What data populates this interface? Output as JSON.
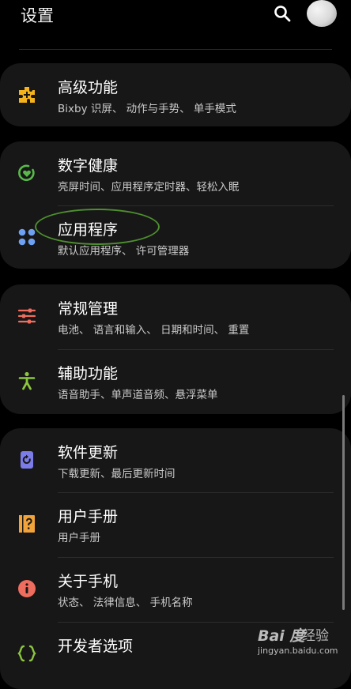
{
  "header": {
    "title": "设置"
  },
  "groups": [
    {
      "items": [
        {
          "label": "高级功能",
          "subtitle": "Bixby 识屏、 动作与手势、 单手模式",
          "icon": "puzzle-icon",
          "icon_color": "#f5b21a"
        }
      ]
    },
    {
      "items": [
        {
          "label": "数字健康",
          "subtitle": "亮屏时间、应用程序定时器、轻松入眠",
          "icon": "digital-wellbeing-icon",
          "icon_color": "#58b94a"
        },
        {
          "label": "应用程序",
          "subtitle": "默认应用程序、 许可管理器",
          "icon": "apps-grid-icon",
          "icon_color": "#6fa1f2"
        }
      ]
    },
    {
      "items": [
        {
          "label": "常规管理",
          "subtitle": "电池、 语言和输入、 日期和时间、 重置",
          "icon": "sliders-icon",
          "icon_color": "#ef6d5e"
        },
        {
          "label": "辅助功能",
          "subtitle": "语音助手、单声道音频、悬浮菜单",
          "icon": "accessibility-icon",
          "icon_color": "#8cc63f"
        }
      ]
    },
    {
      "items": [
        {
          "label": "软件更新",
          "subtitle": "下载更新、最后更新时间",
          "icon": "software-update-icon",
          "icon_color": "#7b7ce8"
        },
        {
          "label": "用户手册",
          "subtitle": "用户手册",
          "icon": "user-manual-icon",
          "icon_color": "#f2a33a"
        },
        {
          "label": "关于手机",
          "subtitle": "状态、 法律信息、 手机名称",
          "icon": "info-icon",
          "icon_color": "#ef6d5e"
        },
        {
          "label": "开发者选项",
          "subtitle": "",
          "icon": "developer-options-icon",
          "icon_color": "#8cc63f"
        }
      ]
    }
  ],
  "watermark": {
    "logo": "Bai 度",
    "cn": "经验",
    "url": "jingyan.baidu.com"
  }
}
